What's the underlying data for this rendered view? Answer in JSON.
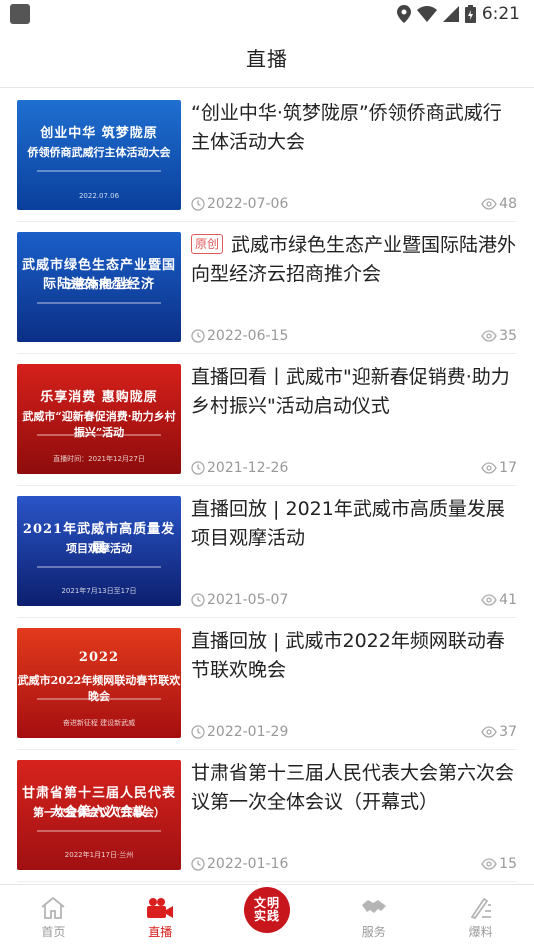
{
  "status_bar": {
    "time": "6:21"
  },
  "header": {
    "title": "直播"
  },
  "items": [
    {
      "title": "“创业中华·筑梦陇原”侨领侨商武威行主体活动大会",
      "tag": "",
      "date": "2022-07-06",
      "views": "48",
      "thumb": {
        "line1": "创业中华 筑梦陇原",
        "line2": "侨领侨商武威行主体活动大会",
        "line3": "2022.07.06",
        "bg_from": "#1f6fd1",
        "bg_to": "#0a3f9c"
      }
    },
    {
      "title": "武威市绿色生态产业暨国际陆港外向型经济云招商推介会",
      "tag": "原创",
      "date": "2022-06-15",
      "views": "35",
      "thumb": {
        "line1": "武威市绿色生态产业暨国际陆港外向型经济",
        "line2": "云招商推介会",
        "line3": "",
        "bg_from": "#1a5fc8",
        "bg_to": "#0b2f86"
      }
    },
    {
      "title": "直播回看丨武威市\"迎新春促销费·助力乡村振兴\"活动启动仪式",
      "tag": "",
      "date": "2021-12-26",
      "views": "17",
      "thumb": {
        "line1": "乐享消费 惠购陇原",
        "line2": "武威市“迎新春促消费·助力乡村振兴”活动",
        "line3": "直播时间：2021年12月27日",
        "bg_from": "#d6201b",
        "bg_to": "#8e0c0c"
      }
    },
    {
      "title": "直播回放 | 2021年武威市高质量发展项目观摩活动",
      "tag": "",
      "date": "2021-05-07",
      "views": "41",
      "thumb": {
        "line1": "2021年武威市高质量发展",
        "line2": "项目观摩活动",
        "line3": "2021年7月13日至17日",
        "bg_from": "#2a55c7",
        "bg_to": "#0c1f6e"
      }
    },
    {
      "title": "直播回放 | 武威市2022年频网联动春节联欢晚会",
      "tag": "",
      "date": "2022-01-29",
      "views": "37",
      "thumb": {
        "line1": "2022",
        "line2": "武威市2022年频网联动春节联欢晚会",
        "line3": "奋进新征程 建设新武威",
        "bg_from": "#e23a1c",
        "bg_to": "#a50e10"
      }
    },
    {
      "title": "甘肃省第十三届人民代表大会第六次会议第一次全体会议（开幕式）",
      "tag": "",
      "date": "2022-01-16",
      "views": "15",
      "thumb": {
        "line1": "甘肃省第十三届人民代表大会第六次会议",
        "line2": "第一次全体会议（开幕会）",
        "line3": "2022年1月17日·兰州",
        "bg_from": "#d7231d",
        "bg_to": "#a01012"
      }
    }
  ],
  "tabs": [
    {
      "label": "首页",
      "icon": "home-icon",
      "active": false
    },
    {
      "label": "直播",
      "icon": "video-camera-icon",
      "active": true
    },
    {
      "label": "文明实践",
      "icon": "civilization-practice-icon",
      "active": false
    },
    {
      "label": "服务",
      "icon": "handshake-icon",
      "active": false
    },
    {
      "label": "爆料",
      "icon": "edit-icon",
      "active": false
    }
  ],
  "colors": {
    "accent": "#d9201e",
    "inactive": "#9a9a9a",
    "tag": "#e05a5a"
  }
}
